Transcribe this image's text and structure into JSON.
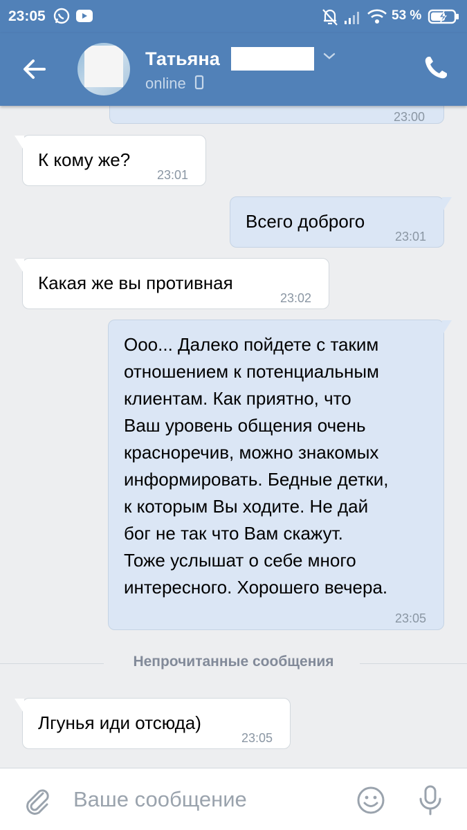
{
  "status_bar": {
    "time": "23:05",
    "battery_percent": "53 %",
    "icons": [
      "whatsapp-icon",
      "youtube-icon",
      "bell-off-icon",
      "signal-icon",
      "wifi-icon",
      "battery-charging-icon"
    ]
  },
  "header": {
    "contact_name": "Татьяна",
    "status": "online",
    "icons": [
      "back-arrow-icon",
      "chevron-down-icon",
      "mobile-icon",
      "phone-icon"
    ]
  },
  "messages": [
    {
      "direction": "out",
      "text": "",
      "time": "23:00",
      "partial": true
    },
    {
      "direction": "in",
      "text": "К кому же?",
      "time": "23:01"
    },
    {
      "direction": "out",
      "text": "Всего доброго",
      "time": "23:01"
    },
    {
      "direction": "in",
      "text": "Какая же вы противная",
      "time": "23:02"
    },
    {
      "direction": "out",
      "lines": [
        "Ооо... Далеко пойдете с таким",
        "отношением к потенциальным",
        "клиентам. Как приятно, что",
        "Ваш уровень общения очень",
        "красноречив, можно знакомых",
        "информировать. Бедные детки,",
        "к которым Вы ходите. Не дай",
        "бог не так что Вам скажут.",
        "Тоже услышат о себе много",
        "интересного. Хорошего вечера."
      ],
      "time": "23:05"
    },
    {
      "direction": "in",
      "text": "Лгунья иди отсюда)",
      "time": "23:05"
    }
  ],
  "unread_separator": "Непрочитанные сообщения",
  "composer": {
    "placeholder": "Ваше сообщение",
    "icons": [
      "paperclip-icon",
      "emoji-icon",
      "microphone-icon"
    ]
  },
  "colors": {
    "header_bg": "#5181b8",
    "chat_bg": "#edeef0",
    "incoming_bubble": "#ffffff",
    "outgoing_bubble": "#dbe6f5",
    "timestamp": "#8a96a3"
  }
}
